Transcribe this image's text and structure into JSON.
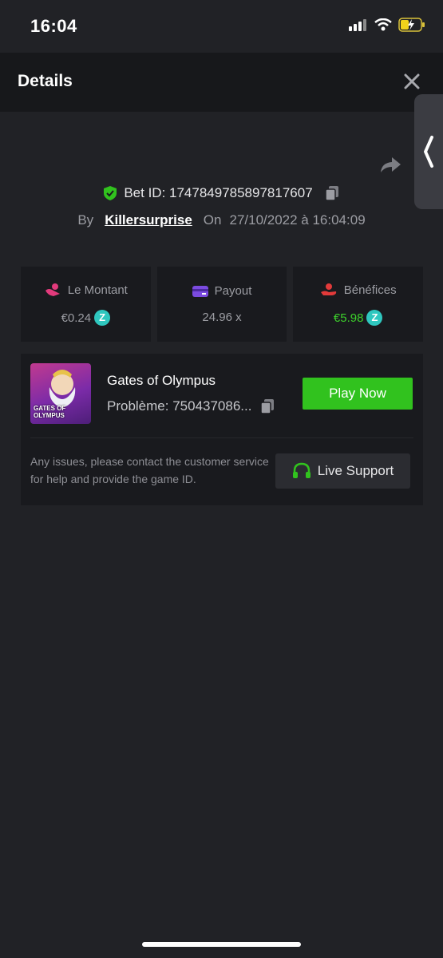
{
  "status": {
    "time": "16:04"
  },
  "header": {
    "title": "Details"
  },
  "bet": {
    "id_text": "Bet ID: 1747849785897817607",
    "by_label": "By",
    "username": "Killersurprise",
    "on_label": "On",
    "datetime": "27/10/2022 à 16:04:09"
  },
  "stats": {
    "amount": {
      "label": "Le Montant",
      "value": "€0.24"
    },
    "payout": {
      "label": "Payout",
      "value": "24.96 x"
    },
    "profit": {
      "label": "Bénéfices",
      "value": "€5.98"
    }
  },
  "game": {
    "name": "Gates of Olympus",
    "thumb_text": "GATES OF OLYMPUS",
    "problem": "Problème: 750437086...",
    "play_label": "Play Now",
    "issues_text": "Any issues, please contact the customer service for help and provide the game ID.",
    "support_label": "Live Support"
  },
  "colors": {
    "accent_green": "#31c21e",
    "profit_green": "#3dd12c",
    "coin_teal": "#2fc7bf"
  }
}
